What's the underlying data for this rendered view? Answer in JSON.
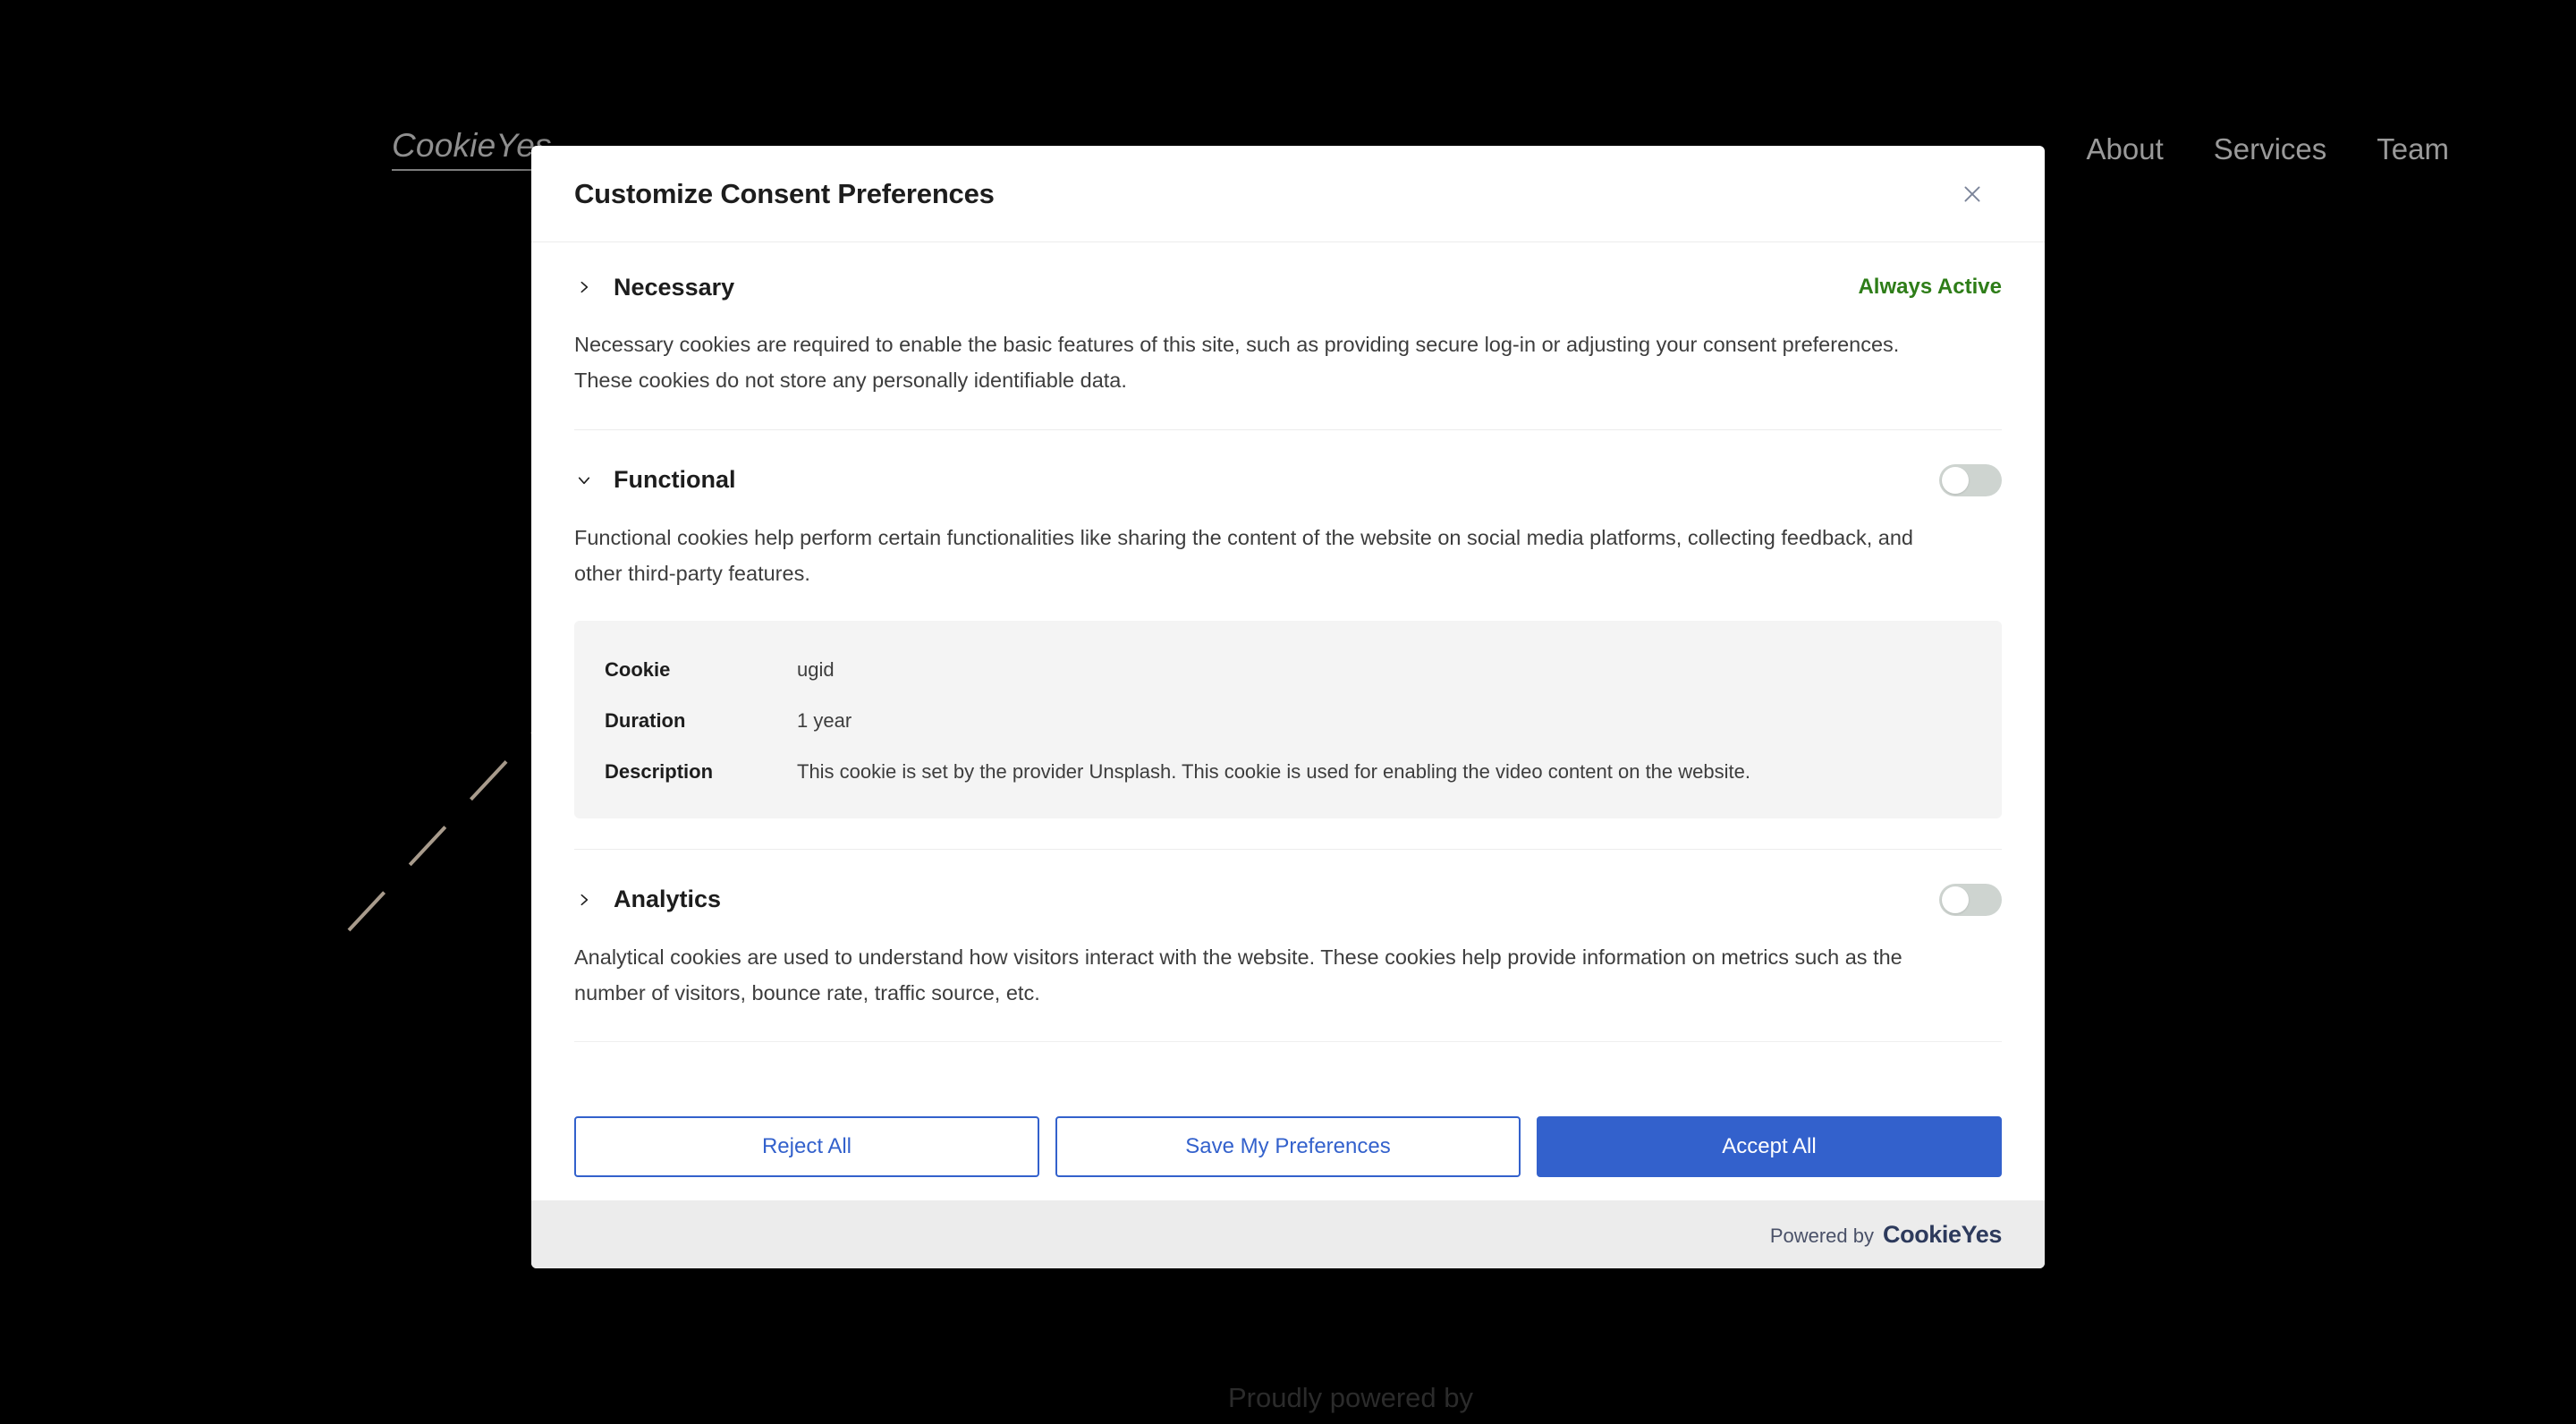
{
  "site": {
    "logo_text": "CookieYes",
    "nav": [
      {
        "label": "About"
      },
      {
        "label": "Services"
      },
      {
        "label": "Team"
      }
    ],
    "footer_text": "Proudly powered by"
  },
  "modal": {
    "title": "Customize Consent Preferences",
    "close_icon": "close-icon",
    "groups": [
      {
        "id": "necessary",
        "title": "Necessary",
        "expanded": false,
        "chevron_icon": "chevron-right-icon",
        "status_label": "Always Active",
        "status_color": "#2e7d18",
        "toggle": null,
        "description": "Necessary cookies are required to enable the basic features of this site, such as providing secure log-in or adjusting your consent preferences. These cookies do not store any personally identifiable data.",
        "cookies": []
      },
      {
        "id": "functional",
        "title": "Functional",
        "expanded": true,
        "chevron_icon": "chevron-down-icon",
        "status_label": null,
        "toggle": {
          "state": "off",
          "on": false
        },
        "description": "Functional cookies help perform certain functionalities like sharing the content of the website on social media platforms, collecting feedback, and other third-party features.",
        "cookies": [
          {
            "rows": [
              {
                "key": "Cookie",
                "value": "ugid"
              },
              {
                "key": "Duration",
                "value": "1 year"
              },
              {
                "key": "Description",
                "value": "This cookie is set by the provider Unsplash. This cookie is used for enabling the video content on the website."
              }
            ]
          }
        ]
      },
      {
        "id": "analytics",
        "title": "Analytics",
        "expanded": false,
        "chevron_icon": "chevron-right-icon",
        "status_label": null,
        "toggle": {
          "state": "off",
          "on": false
        },
        "description": "Analytical cookies are used to understand how visitors interact with the website. These cookies help provide information on metrics such as the number of visitors, bounce rate, traffic source, etc.",
        "cookies": []
      }
    ],
    "actions": {
      "reject_all": "Reject All",
      "save_preferences": "Save My Preferences",
      "accept_all": "Accept All"
    },
    "footer": {
      "powered_by_label": "Powered by",
      "brand": "CookieYes"
    },
    "colors": {
      "accent": "#3361cc",
      "always_active": "#2e7d18",
      "toggle_off_track": "#ced4d0",
      "card_bg": "#f4f4f4",
      "footer_bg": "#ececec",
      "brand_navy": "#2d3a5c"
    }
  }
}
